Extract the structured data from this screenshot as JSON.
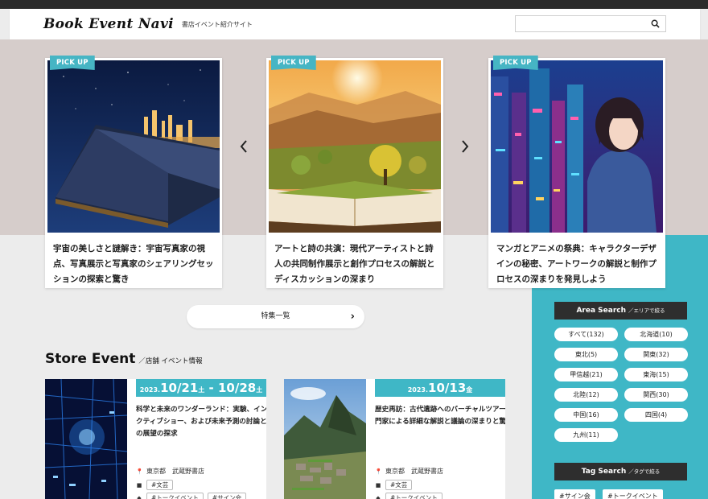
{
  "header": {
    "logo": "Book Event Navi",
    "tagline": "書店イベント紹介サイト",
    "search_placeholder": ""
  },
  "pickup": {
    "badge": "PICK UP",
    "cards": [
      {
        "title": "宇宙の美しさと謎解き：宇宙写真家の視点、写真展示と写真家のシェアリングセッションの探索と驚き"
      },
      {
        "title": "アートと詩の共演：現代アーティストと詩人の共同制作展示と創作プロセスの解説とディスカッションの深まり"
      },
      {
        "title": "マンガとアニメの祭典：キャラクターデザインの秘密、アートワークの解説と制作プロセスの深まりを発見しよう"
      }
    ]
  },
  "feature_list_button": "特集一覧",
  "store_event": {
    "title": "Store Event",
    "subtitle": "／店舗 イベント情報",
    "events": [
      {
        "date_year": "2023.",
        "date_start": "10/21",
        "date_start_week": "土",
        "date_sep": " - ",
        "date_end": "10/28",
        "date_end_week": "土",
        "title": "科学と未来のワンダーランド：実験、インタラクティブショー、および未来予測の討論と未来の展望の探求",
        "location": "東京都　武蔵野書店",
        "category": "#文芸",
        "tags": [
          "#トークイベント",
          "#サイン会"
        ]
      },
      {
        "date_year": "2023.",
        "date_start": "10/13",
        "date_start_week": "金",
        "title": "歴史再訪：古代遺跡へのバーチャルツアー、専門家による詳細な解説と議論の深まりと驚異",
        "location": "東京都　武蔵野書店",
        "category": "#文芸",
        "tags": [
          "#トークイベント"
        ]
      }
    ]
  },
  "area_search": {
    "title": "Area Search",
    "subtitle": "／エリアで絞る",
    "areas": [
      "すべて(132)",
      "北海道(10)",
      "東北(5)",
      "関東(32)",
      "甲信越(21)",
      "東海(15)",
      "北陸(12)",
      "関西(30)",
      "中国(16)",
      "四国(4)",
      "九州(11)"
    ]
  },
  "tag_search": {
    "title": "Tag Search",
    "subtitle": "／タグで絞る",
    "tags": [
      "#サイン会",
      "#トークイベント"
    ]
  },
  "colors": {
    "accent": "#3fb7c6",
    "dark": "#2e2e2e",
    "hero_bg": "#d6cdcb"
  }
}
